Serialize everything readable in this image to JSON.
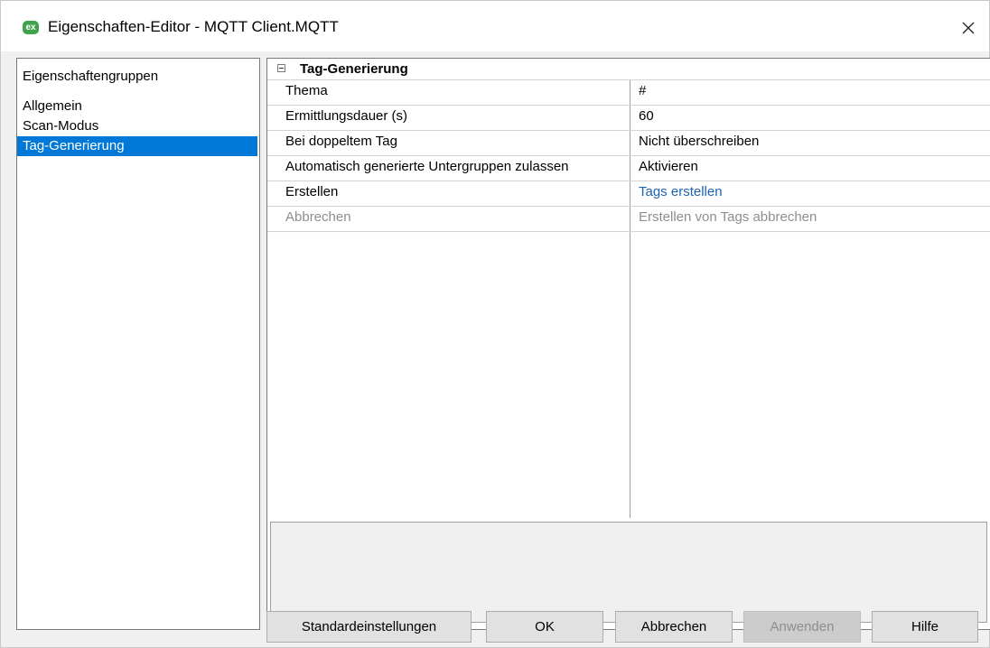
{
  "window": {
    "title": "Eigenschaften-Editor - MQTT Client.MQTT",
    "app_icon_text": "ex",
    "close_glyph": "×"
  },
  "property_groups": {
    "header": "Eigenschaftengruppen",
    "items": [
      {
        "label": "Allgemein",
        "selected": false
      },
      {
        "label": "Scan-Modus",
        "selected": false
      },
      {
        "label": "Tag-Generierung",
        "selected": true
      }
    ]
  },
  "property_grid": {
    "group_title": "Tag-Generierung",
    "rows": [
      {
        "name": "Thema",
        "value": "#",
        "disabled": false,
        "link": false
      },
      {
        "name": "Ermittlungsdauer (s)",
        "value": "60",
        "disabled": false,
        "link": false
      },
      {
        "name": "Bei doppeltem Tag",
        "value": "Nicht überschreiben",
        "disabled": false,
        "link": false
      },
      {
        "name": "Automatisch generierte Untergruppen zulassen",
        "value": "Aktivieren",
        "disabled": false,
        "link": false
      },
      {
        "name": "Erstellen",
        "value": "Tags erstellen",
        "disabled": false,
        "link": true
      },
      {
        "name": "Abbrechen",
        "value": "Erstellen von Tags abbrechen",
        "disabled": true,
        "link": false
      }
    ]
  },
  "buttons": {
    "defaults": "Standardeinstellungen",
    "ok": "OK",
    "cancel": "Abbrechen",
    "apply": "Anwenden",
    "help": "Hilfe"
  },
  "colors": {
    "selection": "#0078d7",
    "link": "#1c63b5",
    "app_icon": "#3fa34d"
  }
}
